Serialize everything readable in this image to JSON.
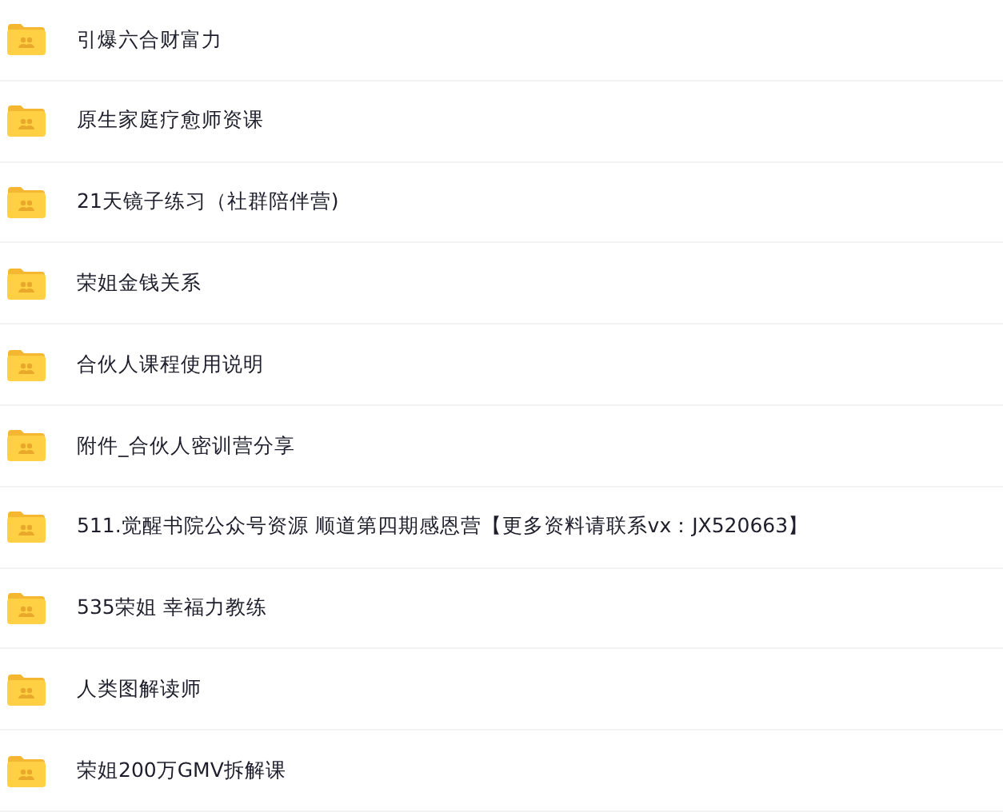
{
  "folders": [
    {
      "name": "引爆六合财富力"
    },
    {
      "name": "原生家庭疗愈师资课"
    },
    {
      "name": "21天镜子练习（社群陪伴营)"
    },
    {
      "name": "荣姐金钱关系"
    },
    {
      "name": "合伙人课程使用说明"
    },
    {
      "name": "附件_合伙人密训营分享"
    },
    {
      "name": "511.觉醒书院公众号资源 顺道第四期感恩营【更多资料请联系vx：JX520663】"
    },
    {
      "name": "535荣姐 幸福力教练"
    },
    {
      "name": "人类图解读师"
    },
    {
      "name": "荣姐200万GMV拆解课"
    }
  ]
}
